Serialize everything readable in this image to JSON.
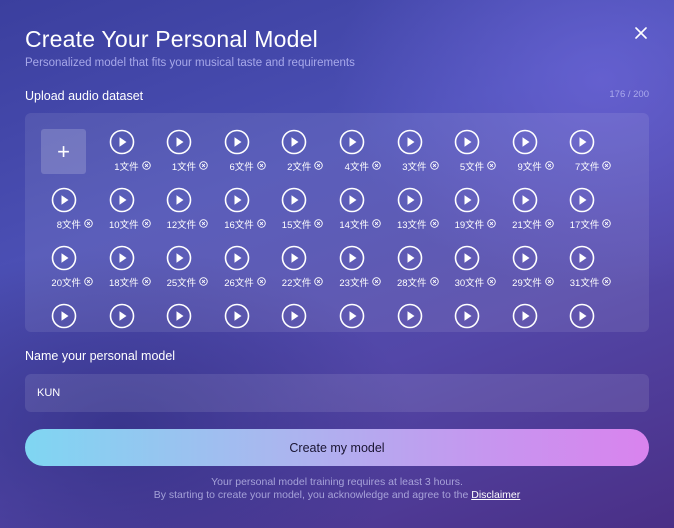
{
  "dialog": {
    "title": "Create Your Personal Model",
    "subtitle": "Personalized model that fits your musical taste and requirements",
    "close_icon": "close-icon"
  },
  "upload": {
    "label": "Upload audio dataset",
    "counter": "176 / 200",
    "add_icon": "plus-icon",
    "files": [
      "1文件",
      "1文件",
      "6文件",
      "2文件",
      "4文件",
      "3文件",
      "5文件",
      "9文件",
      "7文件",
      "8文件",
      "10文件",
      "12文件",
      "16文件",
      "15文件",
      "14文件",
      "13文件",
      "19文件",
      "21文件",
      "17文件",
      "20文件",
      "18文件",
      "25文件",
      "26文件",
      "22文件",
      "23文件",
      "28文件",
      "30文件",
      "29文件",
      "31文件"
    ],
    "partial_row_count": 10
  },
  "model_name": {
    "label": "Name your personal model",
    "value": "KUN"
  },
  "actions": {
    "create_label": "Create my model"
  },
  "notes": {
    "line1": "Your personal model training requires at least 3 hours.",
    "line2_prefix": "By starting to create your model, you acknowledge and agree to the ",
    "disclaimer_link": "Disclaimer"
  },
  "colors": {
    "button_gradient_start": "#7fd6f2",
    "button_gradient_end": "#d983ee",
    "background": "#4b4fb4"
  }
}
